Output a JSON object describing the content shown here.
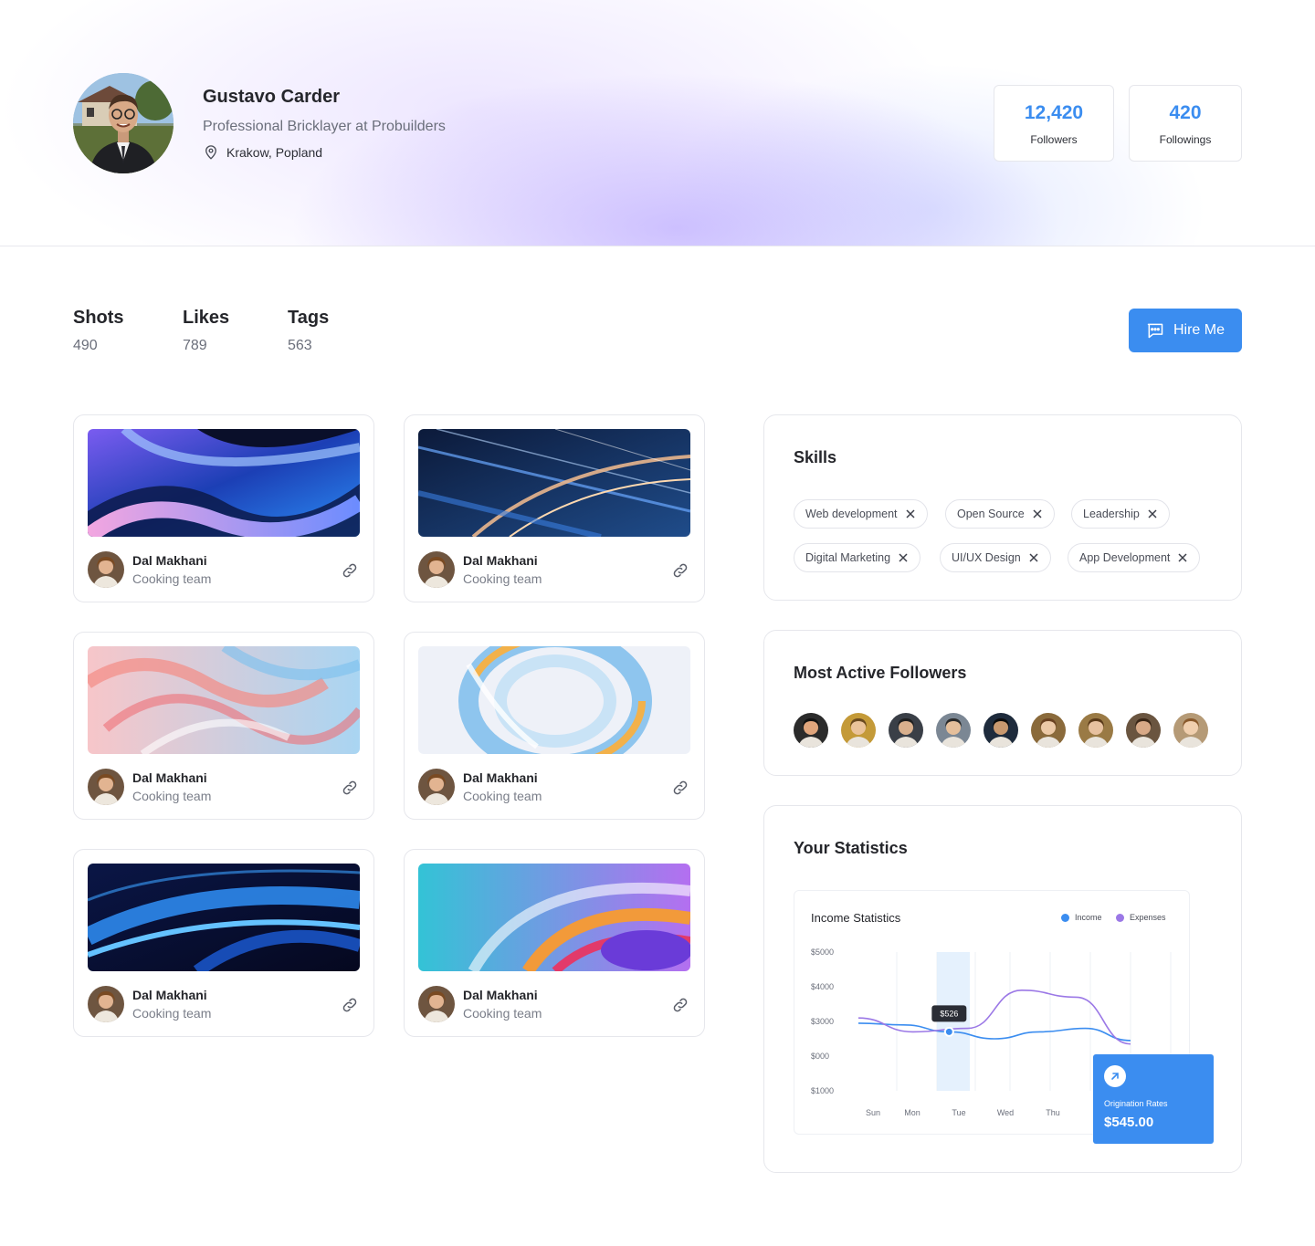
{
  "profile": {
    "name": "Gustavo Carder",
    "title": "Professional Bricklayer at Probuilders",
    "location": "Krakow, Popland",
    "followers": {
      "value": "12,420",
      "label": "Followers"
    },
    "followings": {
      "value": "420",
      "label": "Followings"
    }
  },
  "counters": [
    {
      "label": "Shots",
      "value": "490"
    },
    {
      "label": "Likes",
      "value": "789"
    },
    {
      "label": "Tags",
      "value": "563"
    }
  ],
  "hire_button": {
    "label": "Hire Me"
  },
  "shots": [
    {
      "author": "Dal Makhani",
      "team": "Cooking team"
    },
    {
      "author": "Dal Makhani",
      "team": "Cooking team"
    },
    {
      "author": "Dal Makhani",
      "team": "Cooking team"
    },
    {
      "author": "Dal Makhani",
      "team": "Cooking team"
    },
    {
      "author": "Dal Makhani",
      "team": "Cooking team"
    },
    {
      "author": "Dal Makhani",
      "team": "Cooking team"
    }
  ],
  "skills": {
    "title": "Skills",
    "items": [
      "Web development",
      "Open Source",
      "Leadership",
      "Digital Marketing",
      "UI/UX Design",
      "App Development"
    ]
  },
  "followers_panel": {
    "title": "Most Active Followers",
    "count": 9
  },
  "statistics": {
    "title": "Your Statistics",
    "origination": {
      "label": "Origination Rates",
      "value": "$545.00"
    }
  },
  "chart_data": {
    "type": "line",
    "title": "Income Statistics",
    "y_tick_labels": [
      "$5000",
      "$4000",
      "$3000",
      "$000",
      "$1000"
    ],
    "categories": [
      "Sun",
      "Mon",
      "Tue",
      "Wed",
      "Thu"
    ],
    "series": [
      {
        "name": "Income",
        "color": "#3b8df0",
        "values": [
          2950,
          2900,
          2700,
          2500,
          2700,
          2800,
          2450
        ]
      },
      {
        "name": "Expenses",
        "color": "#9b78e6",
        "values": [
          3100,
          2700,
          2800,
          3900,
          3700,
          2350
        ]
      }
    ],
    "highlight": {
      "category": "Tue",
      "label": "$526"
    },
    "ylim": [
      1000,
      5000
    ],
    "grid": "vertical",
    "legend": "top-right"
  },
  "colors": {
    "accent": "#3b8df0",
    "expenses": "#9b78e6"
  }
}
